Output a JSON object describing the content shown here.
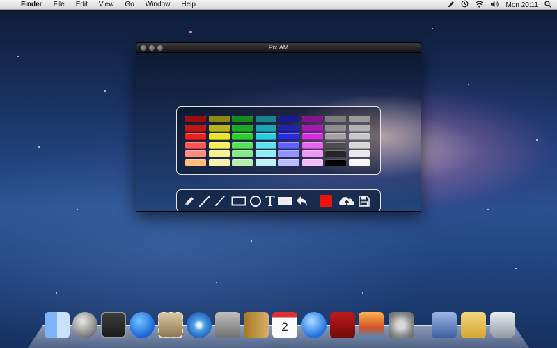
{
  "menubar": {
    "app": "Finder",
    "items": [
      "File",
      "Edit",
      "View",
      "Go",
      "Window",
      "Help"
    ],
    "clock": "Mon 20:11"
  },
  "window": {
    "title": "Pix.AM"
  },
  "palette": {
    "rows": [
      [
        "#9b0c0c",
        "#8d8a12",
        "#178a18",
        "#16848f",
        "#1a1a8e",
        "#86128d",
        "#7d7d7d",
        "#9a9a9a"
      ],
      [
        "#c21616",
        "#b8b41a",
        "#1ea720",
        "#1ba5b1",
        "#2222b0",
        "#a719ae",
        "#8e8e8e",
        "#b2b2b2"
      ],
      [
        "#f01d1d",
        "#e9e423",
        "#27cf2a",
        "#24cfe0",
        "#2929e8",
        "#d62ce0",
        "#a3a3a3",
        "#c8c8c8"
      ],
      [
        "#ff5252",
        "#f3ee5a",
        "#54e255",
        "#5de2ef",
        "#6262ff",
        "#e664ee",
        "#4e4e4e",
        "#d8d8d8"
      ],
      [
        "#ff8a80",
        "#f6f28e",
        "#86e986",
        "#92ecf3",
        "#9494ff",
        "#ee97f4",
        "#262626",
        "#e8e8e8"
      ],
      [
        "#ffbf7a",
        "#f7f0b0",
        "#b5efb0",
        "#bff0f5",
        "#bcbcff",
        "#f4bdf6",
        "#000000",
        "#f7f7f7"
      ]
    ]
  },
  "toolbar": {
    "tools": [
      "pencil-icon",
      "line-icon",
      "brush-icon",
      "rectangle-icon",
      "circle-icon",
      "text-icon",
      "fill-icon",
      "undo-icon",
      "cloud-upload-icon",
      "save-icon"
    ],
    "text_tool_label": "T",
    "current_color": "#ee1111"
  },
  "calendar_date": "2",
  "dock": [
    "finder",
    "launchpad",
    "mission-control",
    "app-store",
    "mail-stamp",
    "safari",
    "facetime",
    "contacts",
    "calendar",
    "itunes",
    "photo-booth",
    "iphoto",
    "system-preferences",
    "applications",
    "documents",
    "trash"
  ]
}
